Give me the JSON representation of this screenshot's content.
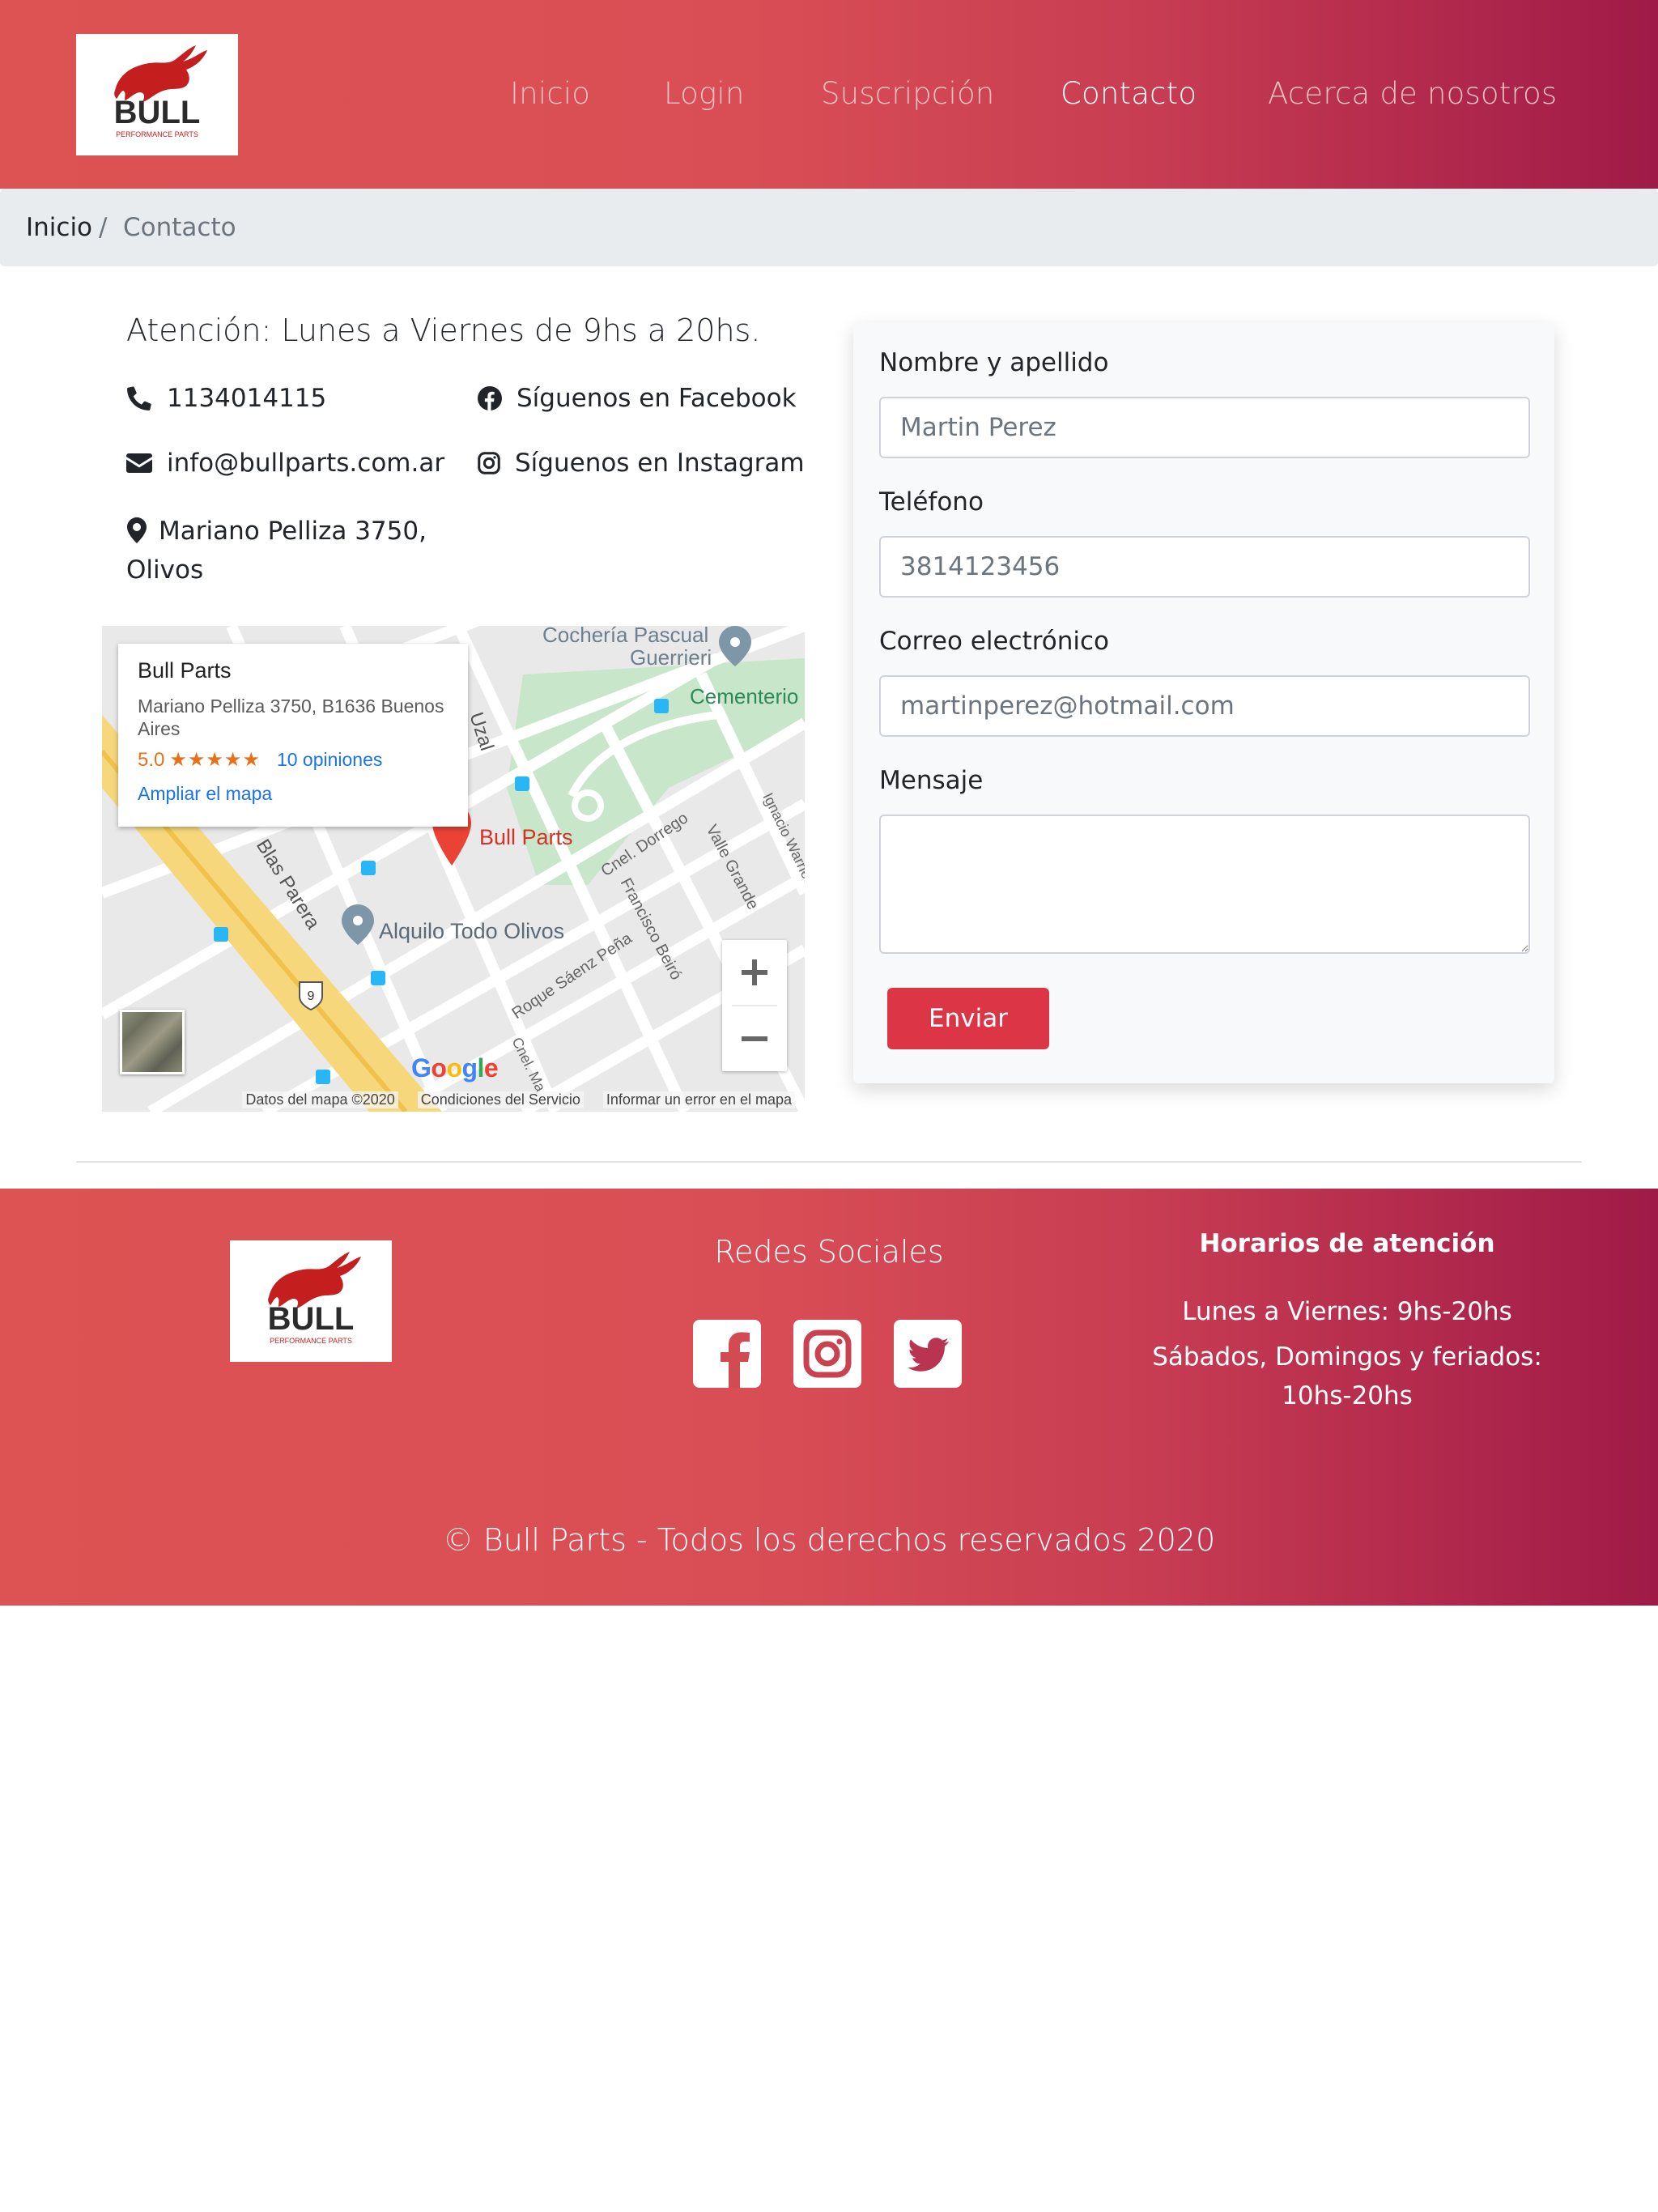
{
  "brand": {
    "logo_text": "BULL",
    "logo_subtext": "PERFORMANCE PARTS",
    "brand_red": "#c41e1e"
  },
  "nav": {
    "items": [
      "Inicio",
      "Login",
      "Suscripción",
      "Contacto",
      "Acerca de nosotros"
    ],
    "active": "Contacto"
  },
  "breadcrumb": {
    "home": "Inicio",
    "separator": "/",
    "current": "Contacto"
  },
  "contact": {
    "attention": "Atención: Lunes a Viernes de 9hs a 20hs.",
    "phone": "1134014115",
    "email": "info@bullparts.com.ar",
    "address": "Mariano Pelliza 3750, Olivos",
    "facebook": "Síguenos en Facebook",
    "instagram": "Síguenos en Instagram"
  },
  "map": {
    "place_name": "Bull Parts",
    "place_address": "Mariano Pelliza 3750, B1636 Buenos Aires",
    "rating": "5.0",
    "stars": "★★★★★",
    "reviews": "10 opiniones",
    "enlarge_link": "Ampliar el mapa",
    "pin_label": "Bull Parts",
    "poi_1": "Cochería Pascual Guerrieri",
    "poi_2": "Cementerio",
    "poi_3": "Alquilo Todo Olivos",
    "streets": [
      "Blas Parera",
      "Uzal",
      "Cnel. Dorrego",
      "Francisco Beiró",
      "Valle Grande",
      "Roque Sáenz Peña",
      "Ignacio Warnes",
      "Cnel. Ma"
    ],
    "route_number": "9",
    "zoom_in": "+",
    "zoom_out": "−",
    "google": "Google",
    "footer_data": "Datos del mapa ©2020",
    "footer_terms": "Condiciones del Servicio",
    "footer_report": "Informar un error en el mapa"
  },
  "form": {
    "name_label": "Nombre y apellido",
    "name_placeholder": "Martin Perez",
    "phone_label": "Teléfono",
    "phone_placeholder": "3814123456",
    "email_label": "Correo electrónico",
    "email_placeholder": "martinperez@hotmail.com",
    "message_label": "Mensaje",
    "message_value": "",
    "submit": "Enviar"
  },
  "footer": {
    "social_title": "Redes Sociales",
    "social_icons": [
      "facebook-icon",
      "instagram-icon",
      "twitter-icon"
    ],
    "hours_title": "Horarios de atención",
    "hours_weekdays": "Lunes a Viernes: 9hs-20hs",
    "hours_weekend": "Sábados, Domingos y feriados: 10hs-20hs",
    "copyright": "© Bull Parts - Todos los derechos reservados 2020"
  },
  "colors": {
    "gradient_start": "#dd5353",
    "gradient_end": "#a01a48",
    "submit_button": "#dc3545",
    "breadcrumb_bg": "#e9ecef",
    "nav_inactive": "#f3c0c1"
  }
}
